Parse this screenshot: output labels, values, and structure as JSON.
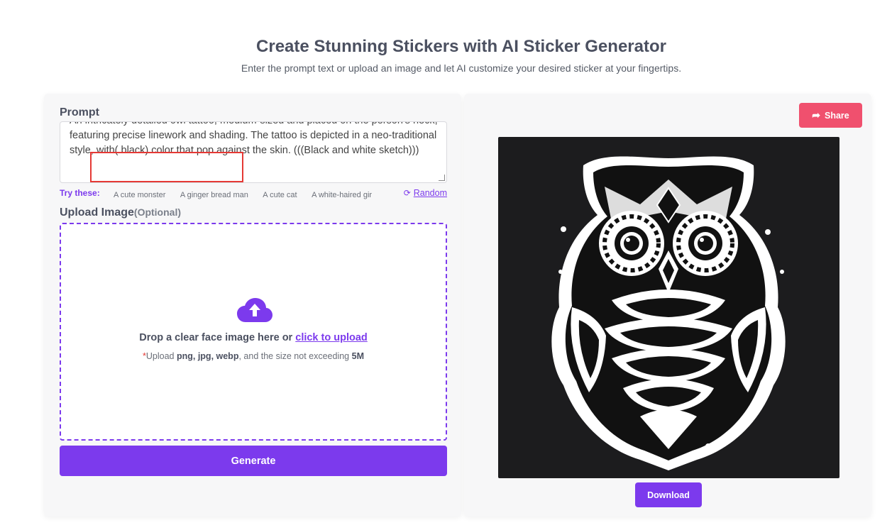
{
  "hero": {
    "title": "Create Stunning Stickers with AI Sticker Generator",
    "subtitle": "Enter the prompt text or upload an image and let AI customize your desired sticker at your fingertips."
  },
  "prompt": {
    "label": "Prompt",
    "value": "An intricately detailed owl tattoo, medium-sized and placed on the person's neck, featuring precise linework and shading. The tattoo is depicted in a neo-traditional style, with( black) color that pop against the skin. (((Black and white sketch)))"
  },
  "try_these": {
    "label": "Try these:",
    "chips": [
      "A cute monster",
      "A ginger bread man",
      "A cute cat",
      "A white-haired gir"
    ],
    "random_label": "Random"
  },
  "upload": {
    "label": "Upload Image",
    "optional": "(Optional)",
    "drop_text": "Drop a clear face image here or",
    "drop_link": "click to upload",
    "note_required": "*",
    "note_prefix": "Upload",
    "note_formats": "png, jpg, webp",
    "note_middle": ", and the size not exceeding",
    "note_size": "5M"
  },
  "actions": {
    "generate_label": "Generate",
    "share_label": "Share",
    "download_label": "Download"
  },
  "icons": {
    "upload": "cloud-upload-icon",
    "random": "refresh-icon",
    "share": "share-arrow-icon"
  },
  "colors": {
    "accent": "#7c3aed",
    "share": "#f0506e",
    "highlight": "#e53935",
    "image_bg": "#1c1c1e"
  }
}
